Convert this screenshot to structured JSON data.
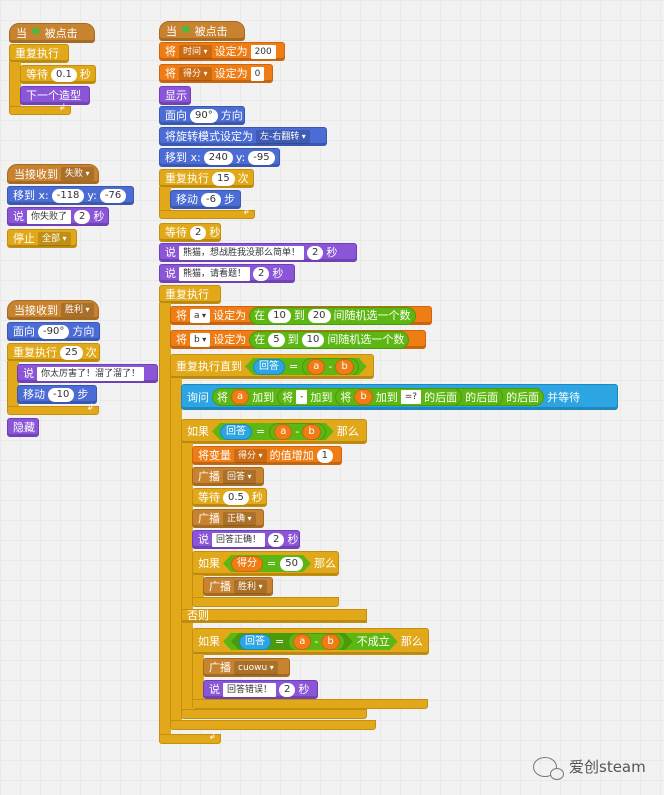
{
  "stack1": {
    "hat_prefix": "当",
    "hat_suffix": "被点击",
    "forever": "重复执行",
    "wait_pre": "等待",
    "wait_val": "0.1",
    "wait_post": "秒",
    "next_costume": "下一个造型"
  },
  "stack2": {
    "hat": "当接收到",
    "hat_msg": "失败",
    "goto_pre": "移到 x:",
    "goto_x": "-118",
    "goto_mid": "y:",
    "goto_y": "-76",
    "say_pre": "说",
    "say_text": "你失败了",
    "say_val": "2",
    "say_post": "秒",
    "stop": "停止",
    "stop_opt": "全部"
  },
  "stack3": {
    "hat": "当接收到",
    "hat_msg": "胜利",
    "dir_pre": "面向",
    "dir_val": "-90°",
    "dir_post": "方向",
    "repeat_pre": "重复执行",
    "repeat_val": "25",
    "repeat_post": "次",
    "say_pre": "说",
    "say_text": "你太厉害了！溜了溜了！",
    "move_pre": "移动",
    "move_val": "-10",
    "move_post": "步",
    "hide": "隐藏"
  },
  "main": {
    "hat_prefix": "当",
    "hat_suffix": "被点击",
    "set1_pre": "将",
    "set1_var": "时间",
    "set1_mid": "设定为",
    "set1_val": "200",
    "set2_pre": "将",
    "set2_var": "得分",
    "set2_mid": "设定为",
    "set2_val": "0",
    "show": "显示",
    "dir_pre": "面向",
    "dir_val": "90°",
    "dir_post": "方向",
    "rot_pre": "将旋转模式设定为",
    "rot_opt": "左-右翻转",
    "goto_pre": "移到 x:",
    "goto_x": "240",
    "goto_mid": "y:",
    "goto_y": "-95",
    "rep_pre": "重复执行",
    "rep_val": "15",
    "rep_post": "次",
    "move_pre": "移动",
    "move_val": "-6",
    "move_post": "步",
    "wait_pre": "等待",
    "wait_val": "2",
    "wait_post": "秒",
    "say1_pre": "说",
    "say1_text": "熊猫，想战胜我没那么简单！",
    "say1_val": "2",
    "say1_post": "秒",
    "say2_pre": "说",
    "say2_text": "熊猫，请看题！",
    "say2_val": "2",
    "say2_post": "秒",
    "forever": "重复执行",
    "seta_pre": "将",
    "seta_var": "a",
    "seta_mid": "设定为",
    "seta_r1": "在",
    "seta_lo": "10",
    "seta_r2": "到",
    "seta_hi": "20",
    "seta_r3": "间随机选一个数",
    "setb_pre": "将",
    "setb_var": "b",
    "setb_mid": "设定为",
    "setb_r1": "在",
    "setb_lo": "5",
    "setb_r2": "到",
    "setb_hi": "10",
    "setb_r3": "间随机选一个数",
    "until_pre": "重复执行直到",
    "until_answer": "回答",
    "until_eq": "=",
    "until_a": "a",
    "until_minus": "-",
    "until_b": "b",
    "ask_pre": "询问",
    "ask_j1": "将",
    "ask_a": "a",
    "ask_jia1": "加到",
    "ask_j2": "将",
    "ask_jia2": "加到",
    "ask_j3": "将",
    "ask_b": "b",
    "ask_jia3": "加到",
    "ask_q": "=?",
    "ask_after1": "的后面",
    "ask_after2": "的后面",
    "ask_after3": "的后面",
    "ask_post": "并等待",
    "if1_pre": "如果",
    "if1_answer": "回答",
    "if1_eq": "=",
    "if1_a": "a",
    "if1_minus": "-",
    "if1_b": "b",
    "if1_post": "那么",
    "chg_pre": "将变量",
    "chg_var": "得分",
    "chg_mid": "的值增加",
    "chg_val": "1",
    "bc1_pre": "广播",
    "bc1_msg": "回答",
    "wait2_pre": "等待",
    "wait2_val": "0.5",
    "wait2_post": "秒",
    "bc2_pre": "广播",
    "bc2_msg": "正确",
    "say3_pre": "说",
    "say3_text": "回答正确！",
    "say3_val": "2",
    "say3_post": "秒",
    "if2_pre": "如果",
    "if2_var": "得分",
    "if2_eq": "=",
    "if2_val": "50",
    "if2_post": "那么",
    "bc3_pre": "广播",
    "bc3_msg": "胜利",
    "else": "否则",
    "if3_pre": "如果",
    "if3_answer": "回答",
    "if3_eq": "=",
    "if3_a": "a",
    "if3_minus": "-",
    "if3_b": "b",
    "if3_not": "不成立",
    "if3_post": "那么",
    "bc4_pre": "广播",
    "bc4_msg": "cuowu",
    "say4_pre": "说",
    "say4_text": "回答错误！",
    "say4_val": "2",
    "say4_post": "秒"
  },
  "watermark": {
    "text": "爱创steam"
  }
}
